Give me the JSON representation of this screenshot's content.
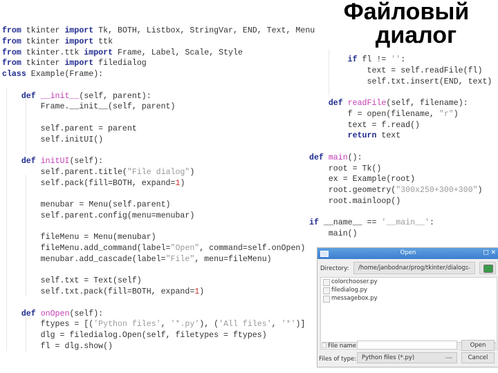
{
  "slide": {
    "title_line1": "Файловый",
    "title_line2": "диалог"
  },
  "code_left": [
    [
      [
        "kw",
        "from"
      ],
      [
        "t",
        " tkinter "
      ],
      [
        "kw",
        "import"
      ],
      [
        "t",
        " Tk, BOTH, Listbox, StringVar, END, Text, Menu"
      ]
    ],
    [
      [
        "kw",
        "from"
      ],
      [
        "t",
        " tkinter "
      ],
      [
        "kw",
        "import"
      ],
      [
        "t",
        " ttk"
      ]
    ],
    [
      [
        "kw",
        "from"
      ],
      [
        "t",
        " tkinter.ttk "
      ],
      [
        "kw",
        "import"
      ],
      [
        "t",
        " Frame, Label, Scale, Style"
      ]
    ],
    [
      [
        "kw",
        "from"
      ],
      [
        "t",
        " tkinter "
      ],
      [
        "kw",
        "import"
      ],
      [
        "t",
        " filedialog"
      ]
    ],
    [
      [
        "kw",
        "class"
      ],
      [
        "t",
        " Example(Frame):"
      ]
    ],
    [
      [
        "t",
        ""
      ]
    ],
    [
      [
        "t",
        "    "
      ],
      [
        "kw",
        "def"
      ],
      [
        "t",
        " "
      ],
      [
        "fn",
        "__init__"
      ],
      [
        "t",
        "(self, parent):"
      ]
    ],
    [
      [
        "t",
        "        Frame.__init__(self, parent)"
      ]
    ],
    [
      [
        "t",
        ""
      ]
    ],
    [
      [
        "t",
        "        self.parent = parent"
      ]
    ],
    [
      [
        "t",
        "        self.initUI()"
      ]
    ],
    [
      [
        "t",
        ""
      ]
    ],
    [
      [
        "t",
        "    "
      ],
      [
        "kw",
        "def"
      ],
      [
        "t",
        " "
      ],
      [
        "fn",
        "initUI"
      ],
      [
        "t",
        "(self):"
      ]
    ],
    [
      [
        "t",
        "        self.parent.title("
      ],
      [
        "str",
        "\"File dialog\""
      ],
      [
        "t",
        ")"
      ]
    ],
    [
      [
        "t",
        "        self.pack(fill=BOTH, expand="
      ],
      [
        "num",
        "1"
      ],
      [
        "t",
        ")"
      ]
    ],
    [
      [
        "t",
        ""
      ]
    ],
    [
      [
        "t",
        "        menubar = Menu(self.parent)"
      ]
    ],
    [
      [
        "t",
        "        self.parent.config(menu=menubar)"
      ]
    ],
    [
      [
        "t",
        ""
      ]
    ],
    [
      [
        "t",
        "        fileMenu = Menu(menubar)"
      ]
    ],
    [
      [
        "t",
        "        fileMenu.add_command(label="
      ],
      [
        "str",
        "\"Open\""
      ],
      [
        "t",
        ", command=self.onOpen)"
      ]
    ],
    [
      [
        "t",
        "        menubar.add_cascade(label="
      ],
      [
        "str",
        "\"File\""
      ],
      [
        "t",
        ", menu=fileMenu)"
      ]
    ],
    [
      [
        "t",
        ""
      ]
    ],
    [
      [
        "t",
        "        self.txt = Text(self)"
      ]
    ],
    [
      [
        "t",
        "        self.txt.pack(fill=BOTH, expand="
      ],
      [
        "num",
        "1"
      ],
      [
        "t",
        ")"
      ]
    ],
    [
      [
        "t",
        ""
      ]
    ],
    [
      [
        "t",
        "    "
      ],
      [
        "kw",
        "def"
      ],
      [
        "t",
        " "
      ],
      [
        "fn",
        "onOpen"
      ],
      [
        "t",
        "(self):"
      ]
    ],
    [
      [
        "t",
        "        ftypes = [("
      ],
      [
        "str",
        "'Python files'"
      ],
      [
        "t",
        ", "
      ],
      [
        "str",
        "'*.py'"
      ],
      [
        "t",
        "), ("
      ],
      [
        "str",
        "'All files'"
      ],
      [
        "t",
        ", "
      ],
      [
        "str",
        "'*'"
      ],
      [
        "t",
        ")]"
      ]
    ],
    [
      [
        "t",
        "        dlg = filedialog.Open(self, filetypes = ftypes)"
      ]
    ],
    [
      [
        "t",
        "        fl = dlg.show()"
      ]
    ]
  ],
  "code_right": [
    [
      [
        "t",
        "        "
      ],
      [
        "kw",
        "if"
      ],
      [
        "t",
        " fl != "
      ],
      [
        "str",
        "''"
      ],
      [
        "t",
        ":"
      ]
    ],
    [
      [
        "t",
        "            text = self.readFile(fl)"
      ]
    ],
    [
      [
        "t",
        "            self.txt.insert(END, text)"
      ]
    ],
    [
      [
        "t",
        ""
      ]
    ],
    [
      [
        "t",
        "    "
      ],
      [
        "kw",
        "def"
      ],
      [
        "t",
        " "
      ],
      [
        "fn",
        "readFile"
      ],
      [
        "t",
        "(self, filename):"
      ]
    ],
    [
      [
        "t",
        "        f = open(filename, "
      ],
      [
        "str",
        "\"r\""
      ],
      [
        "t",
        ")"
      ]
    ],
    [
      [
        "t",
        "        text = f.read()"
      ]
    ],
    [
      [
        "t",
        "        "
      ],
      [
        "kw",
        "return"
      ],
      [
        "t",
        " text"
      ]
    ],
    [
      [
        "t",
        ""
      ]
    ],
    [
      [
        "kw",
        "def"
      ],
      [
        "t",
        " "
      ],
      [
        "fn",
        "main"
      ],
      [
        "t",
        "():"
      ]
    ],
    [
      [
        "t",
        "    root = Tk()"
      ]
    ],
    [
      [
        "t",
        "    ex = Example(root)"
      ]
    ],
    [
      [
        "t",
        "    root.geometry("
      ],
      [
        "str",
        "\"300x250+300+300\""
      ],
      [
        "t",
        ")"
      ]
    ],
    [
      [
        "t",
        "    root.mainloop()"
      ]
    ],
    [
      [
        "t",
        ""
      ]
    ],
    [
      [
        "kw",
        "if"
      ],
      [
        "t",
        " __name__ == "
      ],
      [
        "str",
        "'__main__'"
      ],
      [
        "t",
        ":"
      ]
    ],
    [
      [
        "t",
        "    main()"
      ]
    ]
  ],
  "dialog": {
    "title": "Open",
    "window_buttons": "□ ✕",
    "directory_label": "Directory:",
    "directory_value": "/home/janbodnar/prog/tkinter/dialogs",
    "up_icon": "folder-up-icon",
    "files": [
      "colorchooser.py",
      "filedialog.py",
      "messagebox.py"
    ],
    "file_name_label": "File name:",
    "file_name_value": "",
    "files_of_type_label": "Files of type:",
    "files_of_type_value": "Python files (*.py)",
    "open_label": "Open",
    "cancel_label": "Cancel"
  }
}
